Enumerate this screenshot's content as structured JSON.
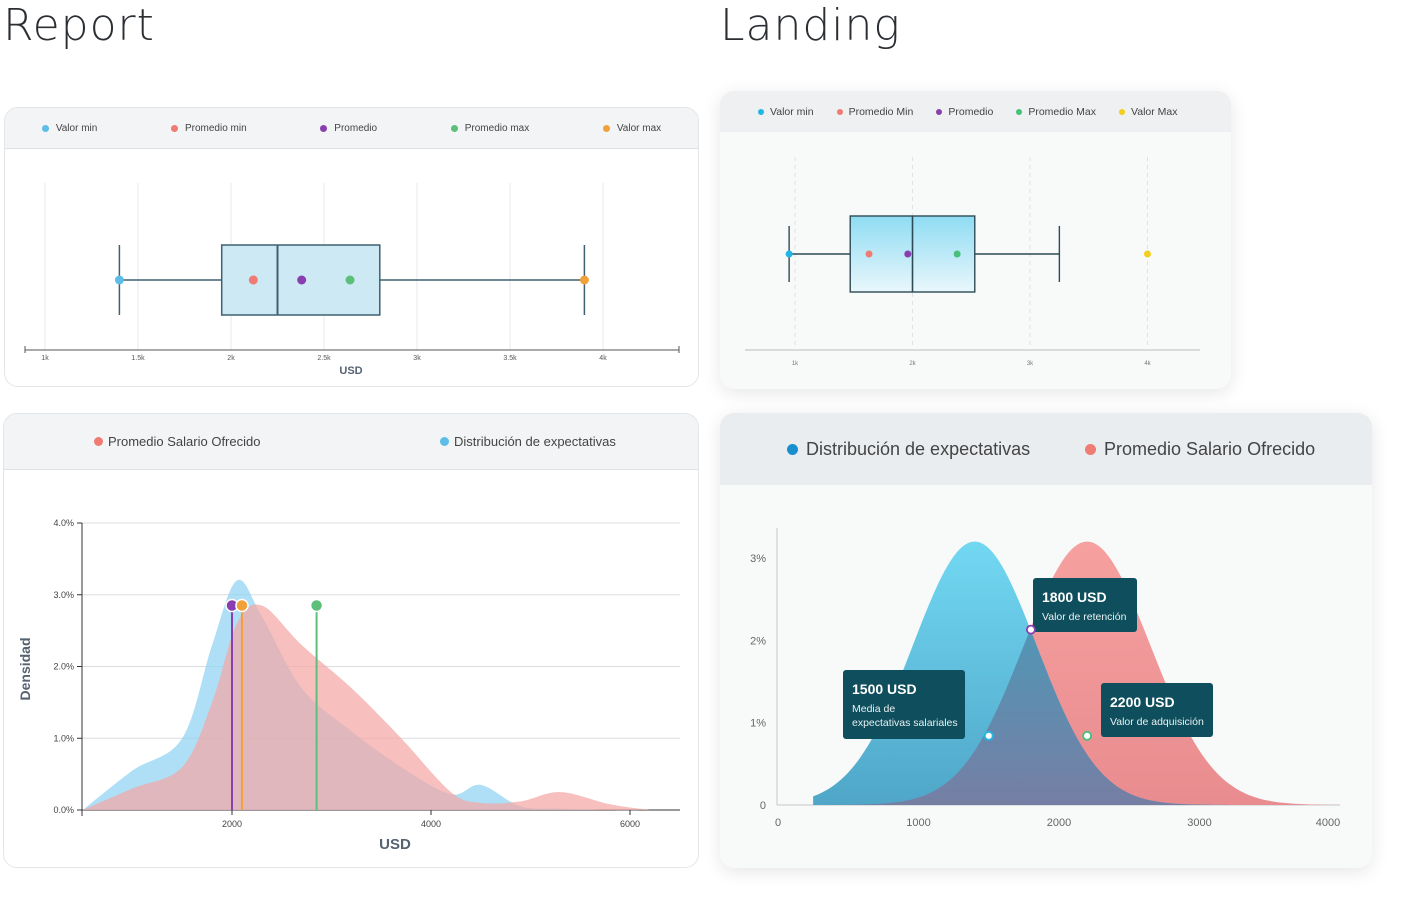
{
  "titles": {
    "report": "Report",
    "landing": "Landing"
  },
  "colors": {
    "report_box_legend": [
      "#5bbde8",
      "#ef7b72",
      "#8a3fb0",
      "#5cbf7a",
      "#f0a13a"
    ],
    "landing_box_legend": [
      "#1fb6e8",
      "#ef7b72",
      "#8a3fb0",
      "#46c07a",
      "#f2cf1f"
    ],
    "dist_blue": "#8fd3f2",
    "dist_red": "#f4a7a5",
    "landing_blue": "#6fd3ee",
    "landing_red": "#f29696",
    "tooltip_bg": "#0f4e5c"
  },
  "report_box": {
    "legend": [
      "Valor min",
      "Promedio min",
      "Promedio",
      "Promedio max",
      "Valor max"
    ],
    "xlabel": "USD",
    "ticks": [
      "1k",
      "1.5k",
      "2k",
      "2.5k",
      "3k",
      "3.5k",
      "4k"
    ]
  },
  "report_dist": {
    "legend": [
      "Promedio Salario Ofrecido",
      "Distribución de expectativas"
    ],
    "xlabel": "USD",
    "ylabel": "Densidad",
    "yticks": [
      "4.0%",
      "3.0%",
      "2.0%",
      "1.0%",
      "0.0%"
    ],
    "xticks": [
      "2000",
      "4000",
      "6000"
    ]
  },
  "landing_box": {
    "legend": [
      "Valor min",
      "Promedio Min",
      "Promedio",
      "Promedio Max",
      "Valor Max"
    ],
    "ticks": [
      "1k",
      "2k",
      "3k",
      "4k"
    ]
  },
  "landing_dist": {
    "legend": [
      "Distribución de expectativas",
      "Promedio Salario Ofrecido"
    ],
    "yticks": [
      "3%",
      "2%",
      "1%",
      "0"
    ],
    "xticks": [
      "0",
      "1000",
      "2000",
      "3000",
      "4000"
    ],
    "tooltips": [
      {
        "value": "1800 USD",
        "lines": [
          "Valor de retención"
        ]
      },
      {
        "value": "1500 USD",
        "lines": [
          "Media de",
          "expectativas salariales"
        ]
      },
      {
        "value": "2200 USD",
        "lines": [
          "Valor de adquisición"
        ]
      }
    ]
  },
  "chart_data": [
    {
      "type": "box",
      "title": "",
      "xlabel": "USD",
      "xlim": [
        900,
        4400
      ],
      "whisker_min": 1400,
      "q1": 1950,
      "median": 2250,
      "q3": 2800,
      "whisker_max": 3900,
      "points": {
        "Valor min": 1400,
        "Promedio min": 2120,
        "Promedio": 2380,
        "Promedio max": 2640,
        "Valor max": 3900
      }
    },
    {
      "type": "area",
      "title": "",
      "xlabel": "USD",
      "ylabel": "Densidad",
      "xlim": [
        500,
        6500
      ],
      "ylim": [
        0,
        4.0
      ],
      "series": [
        {
          "name": "Distribución de expectativas",
          "x": [
            500,
            1000,
            1500,
            1800,
            2050,
            2300,
            2700,
            3200,
            3700,
            4200,
            4500,
            4900,
            5300,
            5800,
            6200
          ],
          "values": [
            0.0,
            0.55,
            1.0,
            2.3,
            3.2,
            2.7,
            1.7,
            1.1,
            0.6,
            0.22,
            0.35,
            0.05,
            0.02,
            0.0,
            0.0
          ]
        },
        {
          "name": "Promedio Salario Ofrecido",
          "x": [
            500,
            1000,
            1500,
            1800,
            2050,
            2300,
            2700,
            3200,
            3700,
            4200,
            4500,
            4900,
            5300,
            5800,
            6200
          ],
          "values": [
            0.0,
            0.3,
            0.6,
            1.5,
            2.6,
            2.85,
            2.3,
            1.7,
            1.0,
            0.25,
            0.1,
            0.12,
            0.25,
            0.08,
            0.0
          ]
        }
      ],
      "markers": [
        {
          "x": 2000,
          "y": 2.85,
          "color": "#8a3fb0"
        },
        {
          "x": 2100,
          "y": 2.85,
          "color": "#f0a13a"
        },
        {
          "x": 2850,
          "y": 2.85,
          "color": "#5cbf7a"
        }
      ]
    },
    {
      "type": "box",
      "title": "",
      "xlim": [
        750,
        4450
      ],
      "whisker_min": 950,
      "q1": 1470,
      "median": 2000,
      "q3": 2530,
      "whisker_max": 3250,
      "points": {
        "Valor min": 950,
        "Promedio Min": 1630,
        "Promedio": 1960,
        "Promedio Max": 2380,
        "Valor Max": 4000
      }
    },
    {
      "type": "area",
      "title": "",
      "xlim": [
        0,
        4000
      ],
      "ylim": [
        0,
        3.4
      ],
      "series": [
        {
          "name": "Distribución de expectativas",
          "mean": 1400,
          "sd": 440,
          "peak": 3.2,
          "start": 250
        },
        {
          "name": "Promedio Salario Ofrecido",
          "mean": 2200,
          "sd": 450,
          "peak": 3.2,
          "start": 250
        }
      ],
      "annotations": [
        {
          "x": 1800,
          "y": 2.13,
          "label": "1800 USD",
          "color": "#8a3fb0"
        },
        {
          "x": 1500,
          "y": 0.84,
          "label": "1500 USD",
          "color": "#1fb6e8"
        },
        {
          "x": 2200,
          "y": 0.84,
          "label": "2200 USD",
          "color": "#46c07a"
        }
      ]
    }
  ]
}
